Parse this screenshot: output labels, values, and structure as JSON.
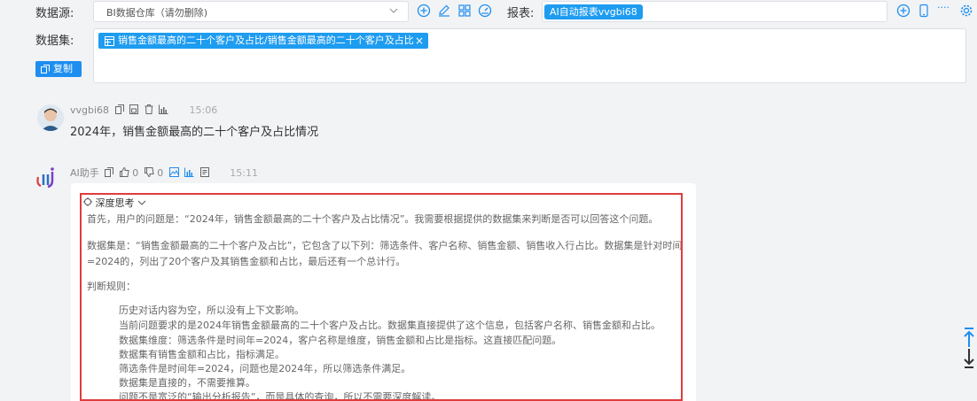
{
  "header": {
    "datasource_label": "数据源:",
    "datasource_value": "BI数据仓库（请勿删除)",
    "report_label": "报表:",
    "report_tag": "AI自动报表vvgbi68",
    "more_label": "····",
    "dataset_label": "数据集:",
    "dataset_tag": "销售金额最高的二十个客户及占比/销售金额最高的二十个客户及占比",
    "dataset_tag_close": "×",
    "copy_button": "复制"
  },
  "colors": {
    "accent": "#1e9cf0",
    "highlight_border": "#e03c3c"
  },
  "messages": {
    "user": {
      "name": "vvgbi68",
      "time": "15:06",
      "text": "2024年，销售金额最高的二十个客户及占比情况"
    },
    "assistant": {
      "name": "AI助手",
      "likes": "0",
      "dislikes": "0",
      "time": "15:11",
      "think_title": "深度思考",
      "lines": [
        "首先，用户的问题是：“2024年，销售金额最高的二十个客户及占比情况”。我需要根据提供的数据集来判断是否可以回答这个问题。",
        "数据集是：“销售金额最高的二十个客户及占比”，它包含了以下列：筛选条件、客户名称、销售金额、销售收入行占比。数据集是针对时间年",
        "=2024的，列出了20个客户及其销售金额和占比，最后还有一个总计行。",
        "判断规则：",
        "历史对话内容为空，所以没有上下文影响。",
        "当前问题要求的是2024年销售金额最高的二十个客户及占比。数据集直接提供了这个信息，包括客户名称、销售金额和占比。",
        "数据集维度：筛选条件是时间年=2024，客户名称是维度，销售金额和占比是指标。这直接匹配问题。",
        "数据集有销售金额和占比，指标满足。",
        "筛选条件是时间年=2024，问题也是2024年，所以筛选条件满足。",
        "数据集是直接的，不需要推算。",
        "问题不是宽泛的“输出分析报告”，而是具体的查询，所以不需要深度解读。"
      ]
    }
  }
}
